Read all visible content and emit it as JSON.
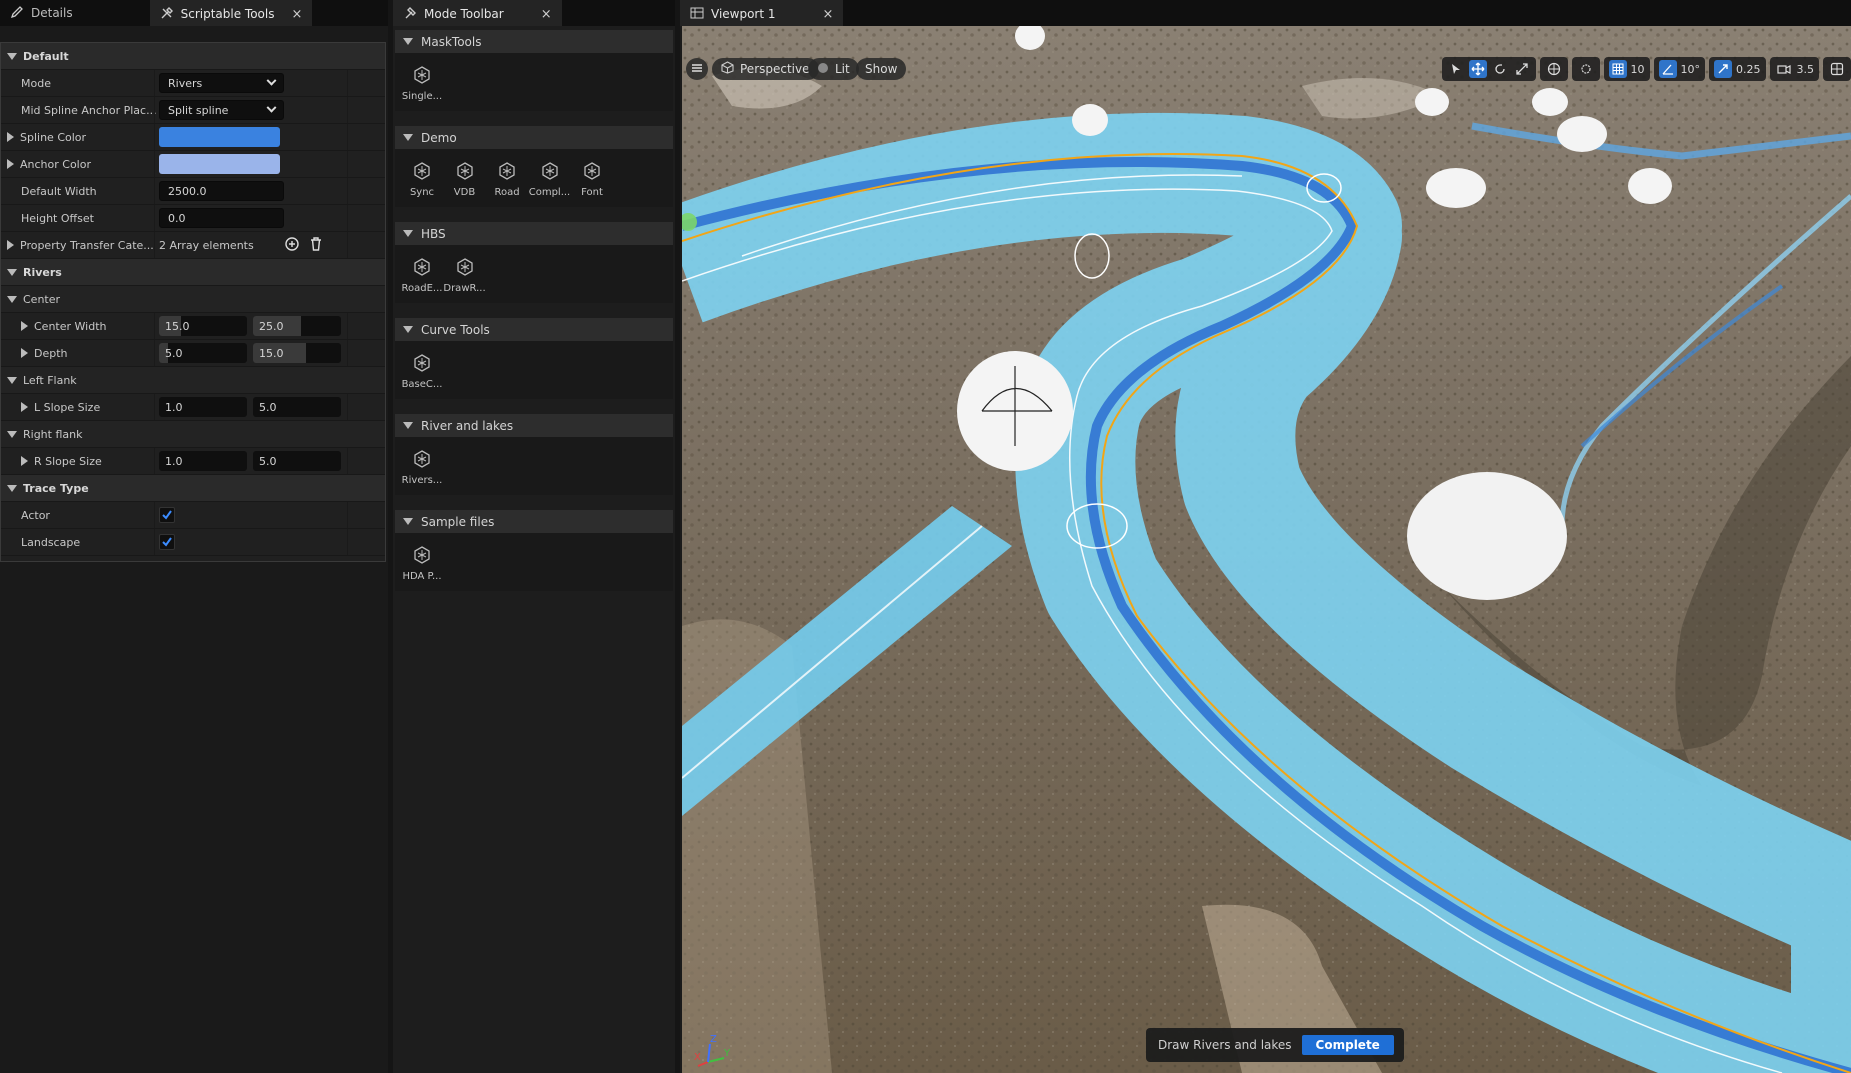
{
  "left_panel": {
    "tabs": [
      {
        "label": "Details",
        "icon": "pencil-icon"
      },
      {
        "label": "Scriptable Tools",
        "icon": "tools-icon",
        "close": "×"
      }
    ],
    "default_header": "Default",
    "mode": {
      "label": "Mode",
      "value": "Rivers"
    },
    "anchor_placement": {
      "label": "Mid Spline Anchor Plac...",
      "value": "Split spline"
    },
    "spline_color": {
      "label": "Spline Color",
      "color": "#3a82e0"
    },
    "anchor_color": {
      "label": "Anchor Color",
      "color": "#9ab4ea"
    },
    "default_width": {
      "label": "Default Width",
      "value": "2500.0"
    },
    "height_offset": {
      "label": "Height Offset",
      "value": "0.0"
    },
    "property_transfer": {
      "label": "Property Transfer Cate...",
      "value": "2 Array elements"
    },
    "rivers_header": "Rivers",
    "center_header": "Center",
    "center_width": {
      "label": "Center Width",
      "min": "15.0",
      "max": "25.0",
      "min_fill": 0.25,
      "max_fill": 0.55
    },
    "depth": {
      "label": "Depth",
      "min": "5.0",
      "max": "15.0",
      "min_fill": 0.1,
      "max_fill": 0.6
    },
    "left_flank_header": "Left Flank",
    "l_slope": {
      "label": "L Slope Size",
      "min": "1.0",
      "max": "5.0"
    },
    "right_flank_header": "Right flank",
    "r_slope": {
      "label": "R Slope Size",
      "min": "1.0",
      "max": "5.0"
    },
    "trace_header": "Trace Type",
    "actor": {
      "label": "Actor",
      "checked": true
    },
    "landscape": {
      "label": "Landscape",
      "checked": true
    }
  },
  "mode_toolbar": {
    "tab": {
      "label": "Mode Toolbar",
      "icon": "hammer-icon",
      "close": "×"
    },
    "sections": [
      {
        "title": "MaskTools",
        "tools": [
          "Single..."
        ]
      },
      {
        "title": "Demo",
        "tools": [
          "Sync",
          "VDB",
          "Road",
          "Compl...",
          "Font"
        ]
      },
      {
        "title": "HBS",
        "tools": [
          "RoadE...",
          "DrawR..."
        ]
      },
      {
        "title": "Curve Tools",
        "tools": [
          "BaseC..."
        ]
      },
      {
        "title": "River and lakes",
        "tools": [
          "Rivers..."
        ]
      },
      {
        "title": "Sample files",
        "tools": [
          "HDA P..."
        ]
      }
    ]
  },
  "viewport": {
    "tab": {
      "label": "Viewport 1",
      "icon": "grid-icon",
      "close": "×"
    },
    "perspective": "Perspective",
    "lit": "Lit",
    "show": "Show",
    "grid_snap": "10",
    "rotation_snap": "10°",
    "scale_snap": "0.25",
    "camera_speed": "3.5",
    "status_text": "Draw Rivers and lakes",
    "complete_label": "Complete",
    "axis": {
      "x": "X",
      "y": "Y",
      "z": "Z"
    }
  }
}
